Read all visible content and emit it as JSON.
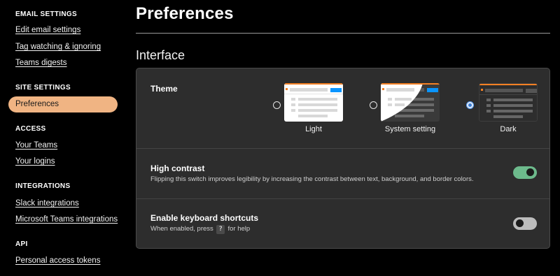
{
  "sidebar": {
    "email_settings": {
      "heading": "EMAIL SETTINGS",
      "items": [
        "Edit email settings",
        "Tag watching & ignoring",
        "Teams digests"
      ]
    },
    "site_settings": {
      "heading": "SITE SETTINGS",
      "items": [
        "Preferences"
      ]
    },
    "access": {
      "heading": "ACCESS",
      "items": [
        "Your Teams",
        "Your logins"
      ]
    },
    "integrations": {
      "heading": "INTEGRATIONS",
      "items": [
        "Slack integrations",
        "Microsoft Teams integrations"
      ]
    },
    "api": {
      "heading": "API",
      "items": [
        "Personal access tokens"
      ]
    },
    "active_item": "Preferences"
  },
  "main": {
    "title": "Preferences",
    "section_title": "Interface",
    "theme": {
      "label": "Theme",
      "options": [
        {
          "label": "Light",
          "selected": false
        },
        {
          "label": "System setting",
          "selected": false
        },
        {
          "label": "Dark",
          "selected": true
        }
      ]
    },
    "high_contrast": {
      "label": "High contrast",
      "description": "Flipping this switch improves legibility by increasing the contrast between text, background, and border colors.",
      "enabled": true
    },
    "keyboard_shortcuts": {
      "label": "Enable keyboard shortcuts",
      "description_before": "When enabled, press",
      "key": "?",
      "description_after": "for help",
      "enabled": false
    }
  },
  "colors": {
    "accent_active": "#f0b483",
    "toggle_on": "#6dba8c",
    "radio_selected": "#3b7bd0",
    "brand_orange": "#f48024",
    "brand_blue": "#0a95ff"
  }
}
